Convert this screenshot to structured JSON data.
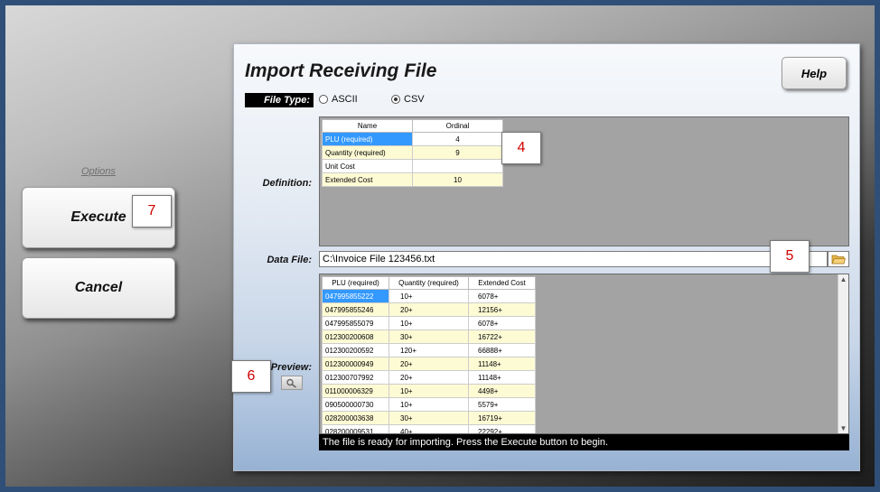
{
  "sidebar": {
    "options_label": "Options",
    "execute_label": "Execute",
    "cancel_label": "Cancel"
  },
  "callouts": {
    "c4": "4",
    "c5": "5",
    "c6": "6",
    "c7": "7"
  },
  "panel": {
    "title": "Import Receiving File",
    "help_label": "Help",
    "file_type_label": "File Type:",
    "file_types": [
      "ASCII",
      "CSV"
    ],
    "file_type_selected": "CSV",
    "definition_label": "Definition:",
    "data_file_label": "Data File:",
    "data_file_value": "C:\\Invoice File 123456.txt",
    "preview_label": "Preview:",
    "status_text": "The file is ready for importing. Press the Execute button to begin."
  },
  "definition": {
    "headers": [
      "Name",
      "Ordinal"
    ],
    "rows": [
      {
        "name": "PLU (required)",
        "ordinal": "4"
      },
      {
        "name": "Quantity (required)",
        "ordinal": "9"
      },
      {
        "name": "Unit Cost",
        "ordinal": ""
      },
      {
        "name": "Extended Cost",
        "ordinal": "10"
      }
    ]
  },
  "preview": {
    "headers": [
      "PLU (required)",
      "Quantity (required)",
      "Extended Cost"
    ],
    "rows": [
      [
        "047995855222",
        "10+",
        "6078+"
      ],
      [
        "047995855246",
        "20+",
        "12156+"
      ],
      [
        "047995855079",
        "10+",
        "6078+"
      ],
      [
        "012300200608",
        "30+",
        "16722+"
      ],
      [
        "012300200592",
        "120+",
        "66888+"
      ],
      [
        "012300000949",
        "20+",
        "11148+"
      ],
      [
        "012300707992",
        "20+",
        "11148+"
      ],
      [
        "011000006329",
        "10+",
        "4498+"
      ],
      [
        "090500000730",
        "10+",
        "5579+"
      ],
      [
        "028200003638",
        "30+",
        "16719+"
      ],
      [
        "028200009531",
        "40+",
        "22292+"
      ]
    ]
  }
}
